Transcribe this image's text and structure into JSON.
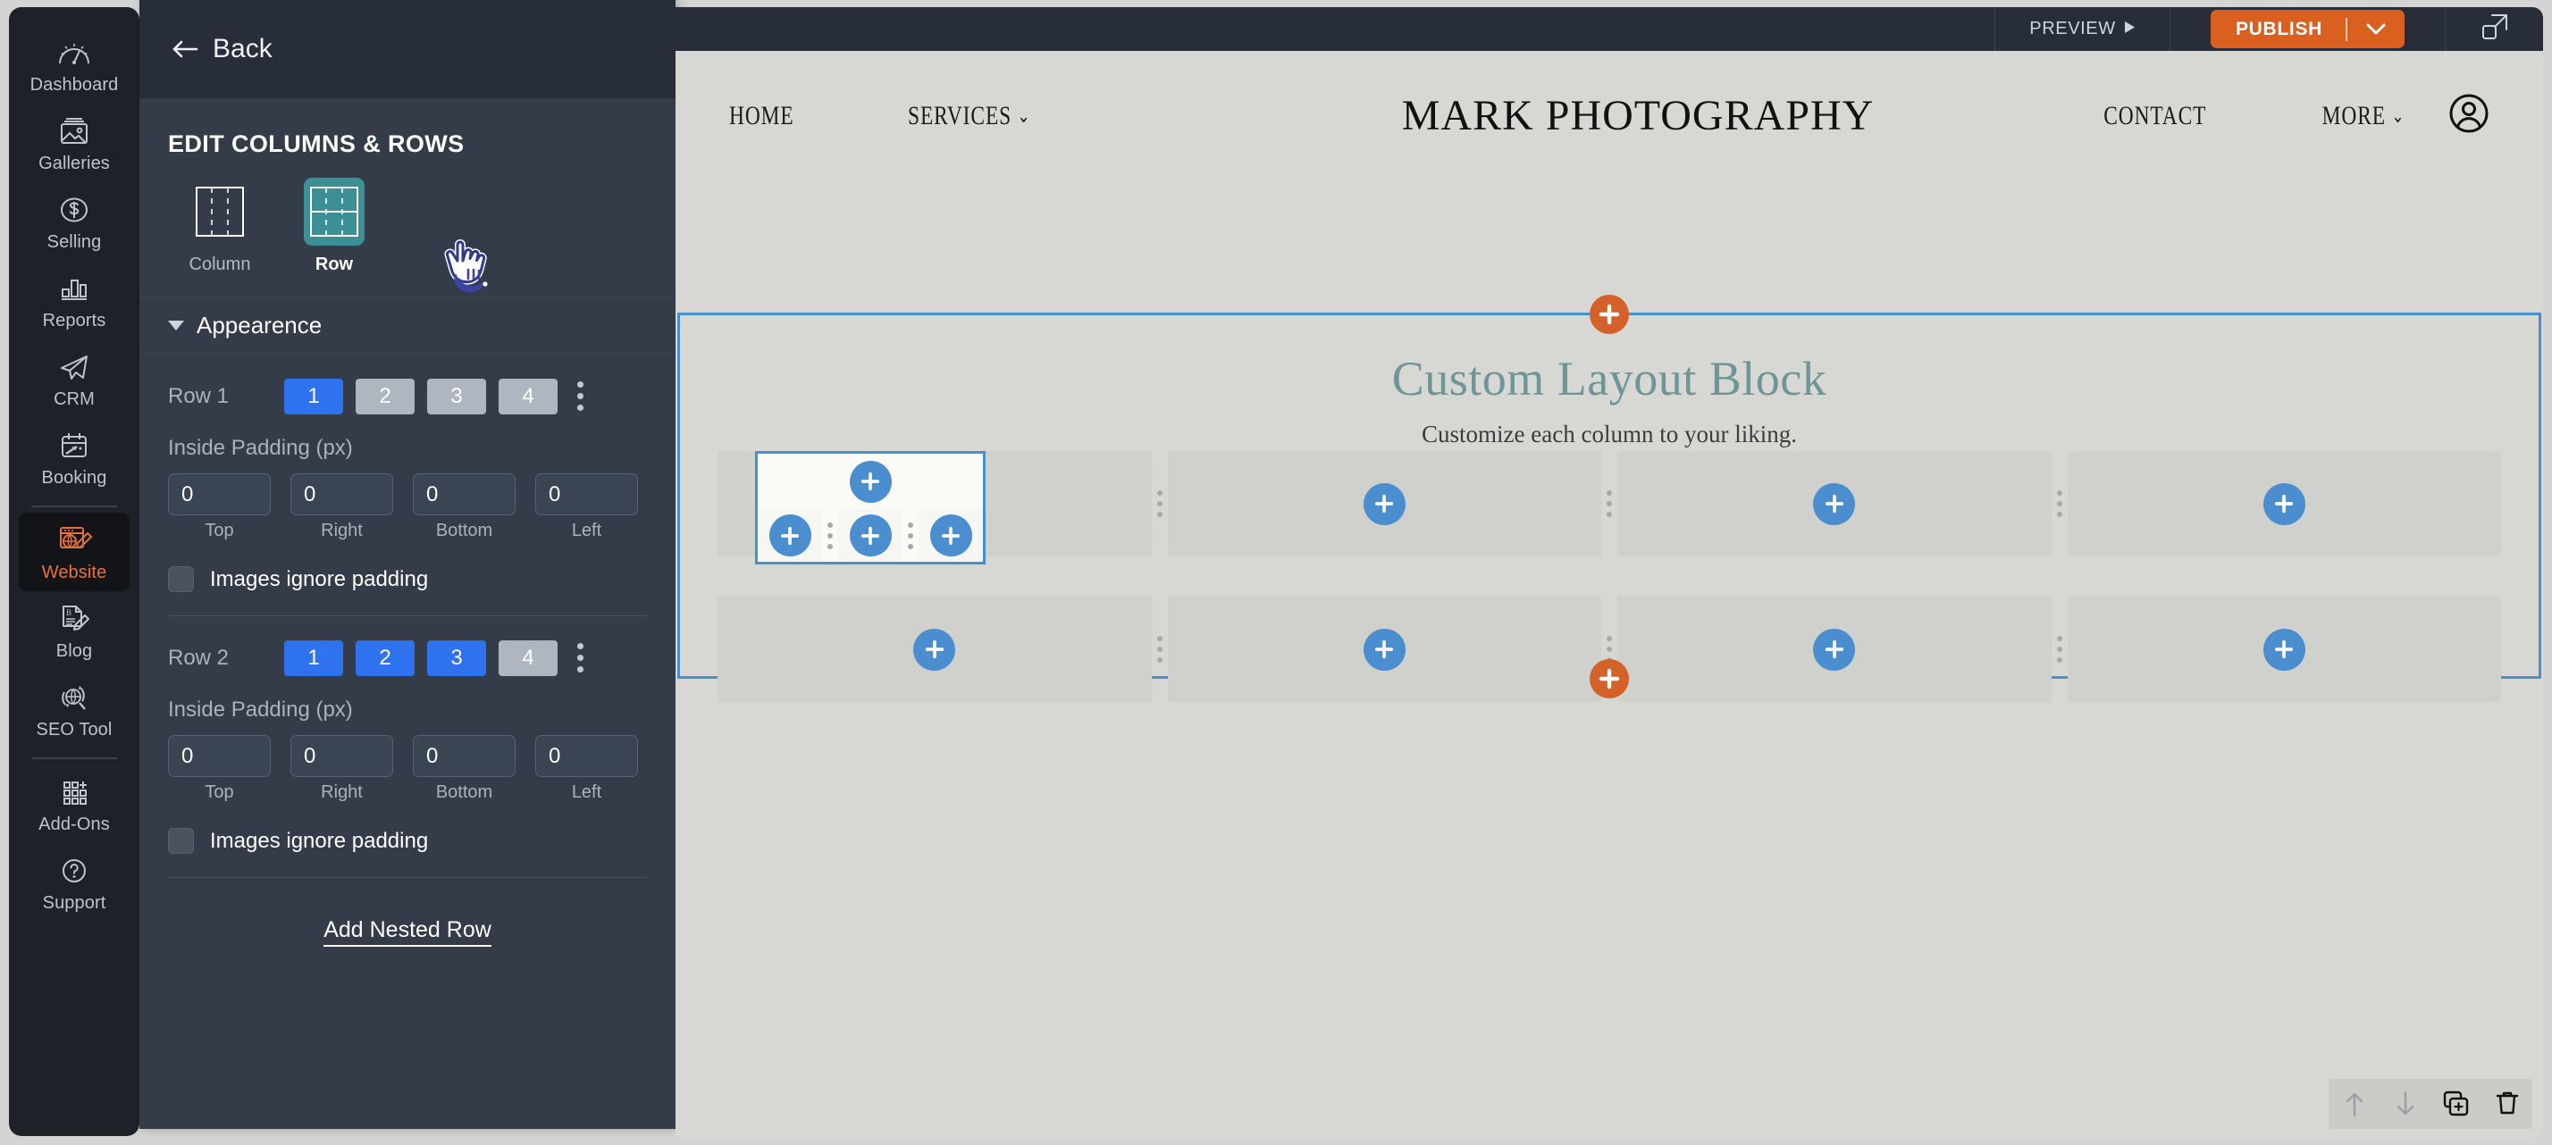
{
  "sidebar": {
    "items": [
      {
        "label": "Dashboard",
        "icon": "gauge-icon",
        "active": false
      },
      {
        "label": "Galleries",
        "icon": "image-icon",
        "active": false
      },
      {
        "label": "Selling",
        "icon": "dollar-circle-icon",
        "active": false
      },
      {
        "label": "Reports",
        "icon": "bar-chart-icon",
        "active": false
      },
      {
        "label": "CRM",
        "icon": "paper-plane-icon",
        "active": false
      },
      {
        "label": "Booking",
        "icon": "calendar-arrow-icon",
        "active": false
      },
      {
        "label": "Website",
        "icon": "browser-pencil-icon",
        "active": true
      },
      {
        "label": "Blog",
        "icon": "document-pencil-icon",
        "active": false
      },
      {
        "label": "SEO Tool",
        "icon": "globe-search-icon",
        "active": false
      },
      {
        "label": "Add-Ons",
        "icon": "grid-plus-icon",
        "active": false
      },
      {
        "label": "Support",
        "icon": "question-circle-icon",
        "active": false
      }
    ],
    "active_color": "#e8703a"
  },
  "panel": {
    "back_label": "Back",
    "title": "EDIT COLUMNS & ROWS",
    "type_options": [
      {
        "label": "Column",
        "selected": false
      },
      {
        "label": "Row",
        "selected": true
      }
    ],
    "selected_type_color": "#3c8f94",
    "accordion_label": "Appearence",
    "padding_title": "Inside Padding (px)",
    "padding_captions": {
      "top": "Top",
      "right": "Right",
      "bottom": "Bottom",
      "left": "Left"
    },
    "checkbox_label": "Images ignore padding",
    "add_nested_label": "Add Nested Row",
    "active_segment_color": "#2f72ef",
    "rows": [
      {
        "label": "Row 1",
        "segments": [
          {
            "value": "1",
            "on": true
          },
          {
            "value": "2",
            "on": false
          },
          {
            "value": "3",
            "on": false
          },
          {
            "value": "4",
            "on": false
          }
        ],
        "padding": {
          "top": "0",
          "right": "0",
          "bottom": "0",
          "left": "0"
        },
        "images_ignore_padding": false
      },
      {
        "label": "Row 2",
        "segments": [
          {
            "value": "1",
            "on": true
          },
          {
            "value": "2",
            "on": true
          },
          {
            "value": "3",
            "on": true
          },
          {
            "value": "4",
            "on": false
          }
        ],
        "padding": {
          "top": "0",
          "right": "0",
          "bottom": "0",
          "left": "0"
        },
        "images_ignore_padding": false
      }
    ]
  },
  "topbar": {
    "preview_label": "PREVIEW",
    "publish_label": "PUBLISH",
    "publish_color": "#da6020",
    "expand_icon": "expand-icon"
  },
  "site": {
    "brand": "MARK PHOTOGRAPHY",
    "nav": [
      {
        "label": "HOME",
        "has_caret": false
      },
      {
        "label": "SERVICES",
        "has_caret": true
      },
      {
        "label": "CONTACT",
        "has_caret": false
      },
      {
        "label": "MORE",
        "has_caret": true
      }
    ],
    "account_icon": "user-circle-icon",
    "block": {
      "title": "Custom Layout Block",
      "title_color": "#6e9598",
      "subtitle": "Customize each column to your liking.",
      "selection_color": "#4a8ed0",
      "add_block_icon": "plus-icon",
      "add_block_color": "#d4602a",
      "row1_columns": 4,
      "row2_columns": 4,
      "nested": {
        "top_cells": 1,
        "bottom_cells": 3
      }
    },
    "toolbar": [
      {
        "icon": "move-up-icon",
        "name": "move-up"
      },
      {
        "icon": "move-down-icon",
        "name": "move-down"
      },
      {
        "icon": "duplicate-icon",
        "name": "duplicate"
      },
      {
        "icon": "trash-icon",
        "name": "delete"
      }
    ]
  }
}
